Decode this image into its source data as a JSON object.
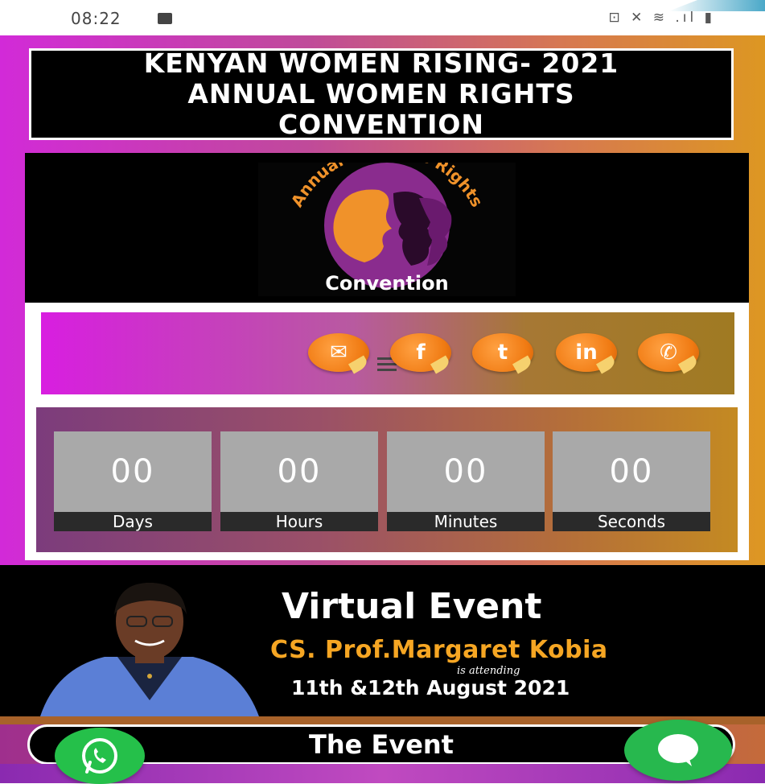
{
  "status_bar": {
    "time": "08:22",
    "icons": "⊡ ✕ ≋ .ıl ▮"
  },
  "header": {
    "title": "KENYAN WOMEN RISING- 2021\nANNUAL WOMEN RIGHTS\nCONVENTION"
  },
  "logo": {
    "arc_text": "Annual Women's Rights",
    "bottom_text": "Convention"
  },
  "share": {
    "buttons": [
      {
        "icon": "email-icon",
        "glyph": "✉"
      },
      {
        "icon": "facebook-icon",
        "glyph": "f"
      },
      {
        "icon": "twitter-icon",
        "glyph": "t"
      },
      {
        "icon": "linkedin-icon",
        "glyph": "in"
      },
      {
        "icon": "whatsapp-icon",
        "glyph": "✆"
      }
    ]
  },
  "countdown": {
    "days": {
      "value": "00",
      "label": "Days"
    },
    "hours": {
      "value": "00",
      "label": "Hours"
    },
    "minutes": {
      "value": "00",
      "label": "Minutes"
    },
    "seconds": {
      "value": "00",
      "label": "Seconds"
    }
  },
  "event_banner": {
    "title": "Virtual Event",
    "speaker": "CS. Prof.Margaret Kobia",
    "attending": "is attending",
    "dates": "11th &12th August 2021"
  },
  "section": {
    "label": "The Event"
  },
  "colors": {
    "accent_orange": "#f6a623",
    "brand_magenta": "#d22ad8",
    "whatsapp_green": "#25c04a"
  }
}
